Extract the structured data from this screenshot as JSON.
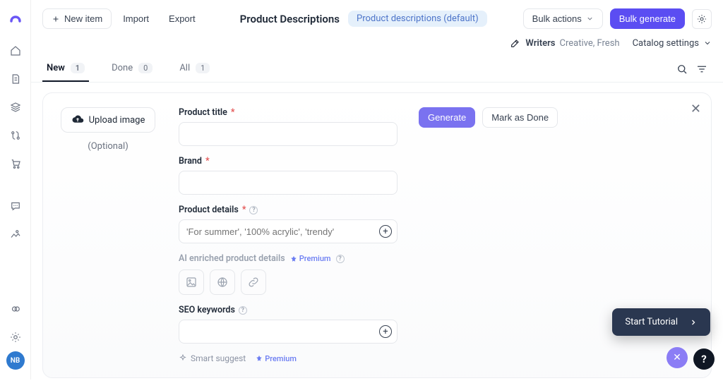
{
  "header": {
    "new_item_label": "New item",
    "import_label": "Import",
    "export_label": "Export",
    "page_title": "Product Descriptions",
    "template_pill": "Product descriptions (default)",
    "bulk_actions_label": "Bulk actions",
    "bulk_generate_label": "Bulk generate"
  },
  "subheader": {
    "writers_label": "Writers",
    "writers_tones": "Creative, Fresh",
    "catalog_settings_label": "Catalog settings"
  },
  "tabs": {
    "new_label": "New",
    "new_count": "1",
    "done_label": "Done",
    "done_count": "0",
    "all_label": "All",
    "all_count": "1"
  },
  "form": {
    "upload_label": "Upload image",
    "upload_optional": "(Optional)",
    "product_title_label": "Product title",
    "brand_label": "Brand",
    "product_details_label": "Product details",
    "product_details_placeholder": "'For summer', '100% acrylic', 'trendy'",
    "ai_enriched_label": "AI enriched product details",
    "premium_tag": "Premium",
    "seo_label": "SEO keywords",
    "smart_suggest_label": "Smart suggest"
  },
  "actions": {
    "generate_label": "Generate",
    "mark_done_label": "Mark as Done",
    "tutorial_label": "Start Tutorial"
  },
  "avatar": {
    "initials": "NB"
  }
}
